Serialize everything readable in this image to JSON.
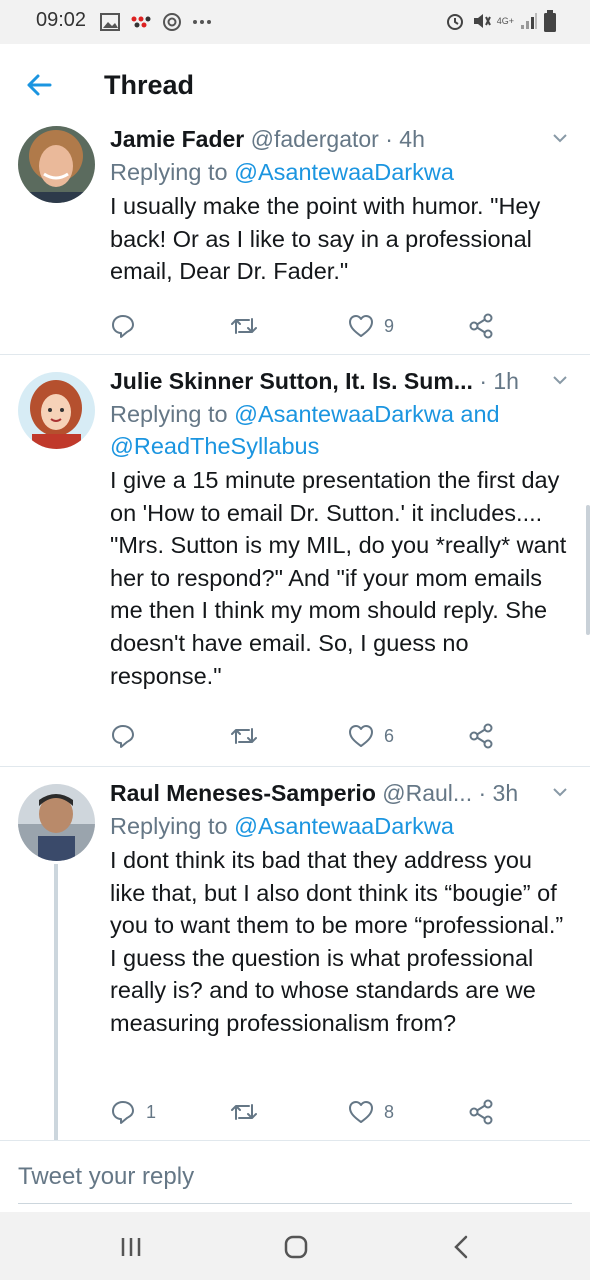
{
  "status_bar": {
    "time": "09:02",
    "network": "4G+"
  },
  "header": {
    "title": "Thread"
  },
  "tweets": [
    {
      "name": "Jamie Fader",
      "handle": "@fadergator",
      "time": "· 4h",
      "replying_prefix": "Replying to ",
      "replying_to": "@AsantewaaDarkwa",
      "text": "I usually make the point with humor. \"Hey back! Or as I like to say in a professional email, Dear Dr. Fader.\"",
      "reply_count": "",
      "retweet_count": "",
      "like_count": "9"
    },
    {
      "name": "Julie Skinner Sutton, It. Is. Sum...",
      "handle": "",
      "time": "· 1h",
      "replying_prefix": "Replying to ",
      "replying_to": "@AsantewaaDarkwa and @ReadTheSyllabus",
      "text": "I give a 15 minute presentation the first day on 'How to email Dr. Sutton.' it includes.... \"Mrs. Sutton is my MIL, do you *really* want her to respond?\" And \"if your mom emails me then I think my mom should reply. She doesn't have email. So, I guess no response.\"",
      "reply_count": "",
      "retweet_count": "",
      "like_count": "6"
    },
    {
      "name": "Raul Meneses-Samperio",
      "handle": "@Raul...",
      "time": "· 3h",
      "replying_prefix": "Replying to ",
      "replying_to": "@AsantewaaDarkwa",
      "text": "I dont think its bad that they address you like that, but I also dont think its “bougie” of you to want them to be more “professional.” I guess the question is what professional really is? and to whose standards are we measuring professionalism from?",
      "reply_count": "1",
      "retweet_count": "",
      "like_count": "8"
    }
  ],
  "reply_bar": {
    "placeholder": "Tweet your reply"
  },
  "colors": {
    "accent": "#1b95e0",
    "secondary_text": "#657786",
    "divider": "#e1e8ed"
  },
  "icons": [
    "back-arrow-icon",
    "reply-icon",
    "retweet-icon",
    "like-icon",
    "share-icon",
    "chevron-down-icon",
    "recents-icon",
    "home-icon",
    "back-icon"
  ]
}
